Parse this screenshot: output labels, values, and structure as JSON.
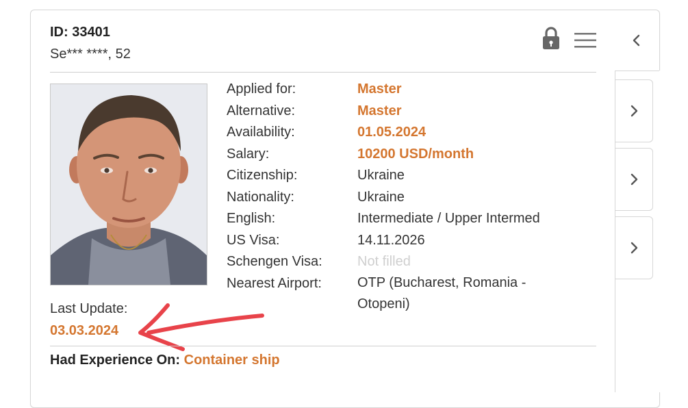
{
  "header": {
    "id_text": "ID: 33401",
    "name_text": "Se*** ****, 52"
  },
  "icons": {
    "lock": "lock-icon",
    "menu": "hamburger-menu-icon",
    "collapse": "chevron-left-icon",
    "expand": "chevron-right-icon"
  },
  "details": [
    {
      "label": "Applied for:",
      "value": "Master",
      "style": "accent"
    },
    {
      "label": "Alternative:",
      "value": "Master",
      "style": "accent"
    },
    {
      "label": "Availability:",
      "value": "01.05.2024",
      "style": "accent"
    },
    {
      "label": "Salary:",
      "value": "10200 USD/month",
      "style": "accent"
    },
    {
      "label": "Citizenship:",
      "value": "Ukraine",
      "style": "normal"
    },
    {
      "label": "Nationality:",
      "value": "Ukraine",
      "style": "normal"
    },
    {
      "label": "English:",
      "value": "Intermediate / Upper Intermed",
      "style": "normal"
    },
    {
      "label": "US Visa:",
      "value": "14.11.2026",
      "style": "normal"
    },
    {
      "label": "Schengen Visa:",
      "value": "Not filled",
      "style": "muted"
    },
    {
      "label": "Nearest Airport:",
      "value": "OTP (Bucharest, Romania - Otopeni)",
      "style": "normal"
    }
  ],
  "last_update": {
    "label": "Last Update:",
    "value": "03.03.2024"
  },
  "experience": {
    "label": "Had Experience On:",
    "value": "Container ship"
  },
  "colors": {
    "accent": "#d4762f",
    "annotation_arrow": "#e8434a",
    "muted": "#cfcfcf"
  }
}
